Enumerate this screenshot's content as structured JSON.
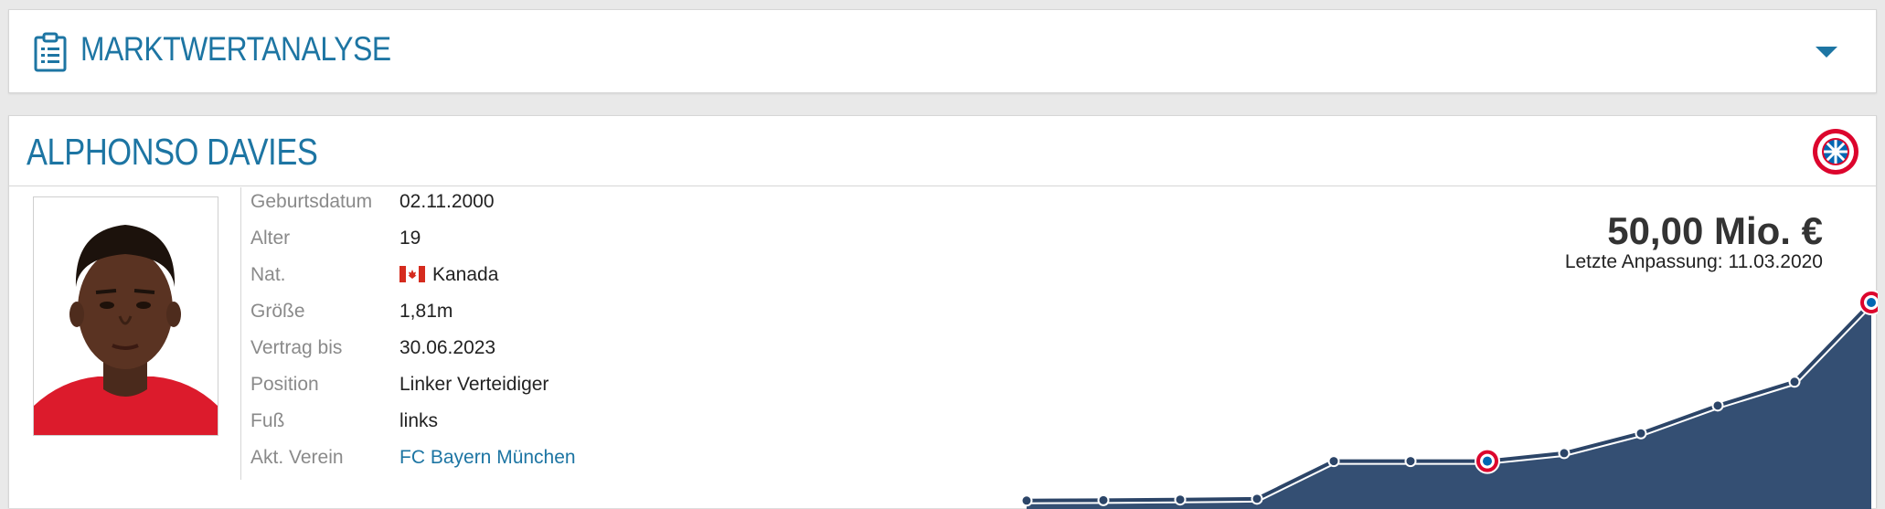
{
  "analysis": {
    "title": "MARKTWERTANALYSE",
    "icon": "clipboard-icon",
    "toggle_icon": "caret-down-icon"
  },
  "player": {
    "name": "ALPHONSO DAVIES",
    "club_badge_icon": "fc-bayern-badge",
    "photo_alt": "player-photo"
  },
  "info": [
    {
      "label": "Geburtsdatum",
      "value": "02.11.2000"
    },
    {
      "label": "Alter",
      "value": "19"
    },
    {
      "label": "Nat.",
      "value": "Kanada",
      "flag": "canada-flag"
    },
    {
      "label": "Größe",
      "value": "1,81m"
    },
    {
      "label": "Vertrag bis",
      "value": "30.06.2023"
    },
    {
      "label": "Position",
      "value": "Linker Verteidiger"
    },
    {
      "label": "Fuß",
      "value": "links"
    },
    {
      "label": "Akt. Verein",
      "value": "FC Bayern München",
      "link": true
    }
  ],
  "market_value": {
    "value": "50,00 Mio. €",
    "updated": "Letzte Anpassung: 11.03.2020"
  },
  "chart_data": {
    "type": "area",
    "title": "",
    "xlabel": "",
    "ylabel": "",
    "unit": "Mio. €",
    "points": [
      0.05,
      0.15,
      0.3,
      0.5,
      10,
      10,
      10,
      12,
      17,
      24,
      30,
      50
    ],
    "club_markers": [
      6,
      11
    ],
    "colors": {
      "fill": "#344f73",
      "line": "#2c4568",
      "marker": "#2c4568",
      "highlight": "#ffffff"
    }
  },
  "colors": {
    "accent": "#1d75a3",
    "background": "#e9e9e9"
  }
}
